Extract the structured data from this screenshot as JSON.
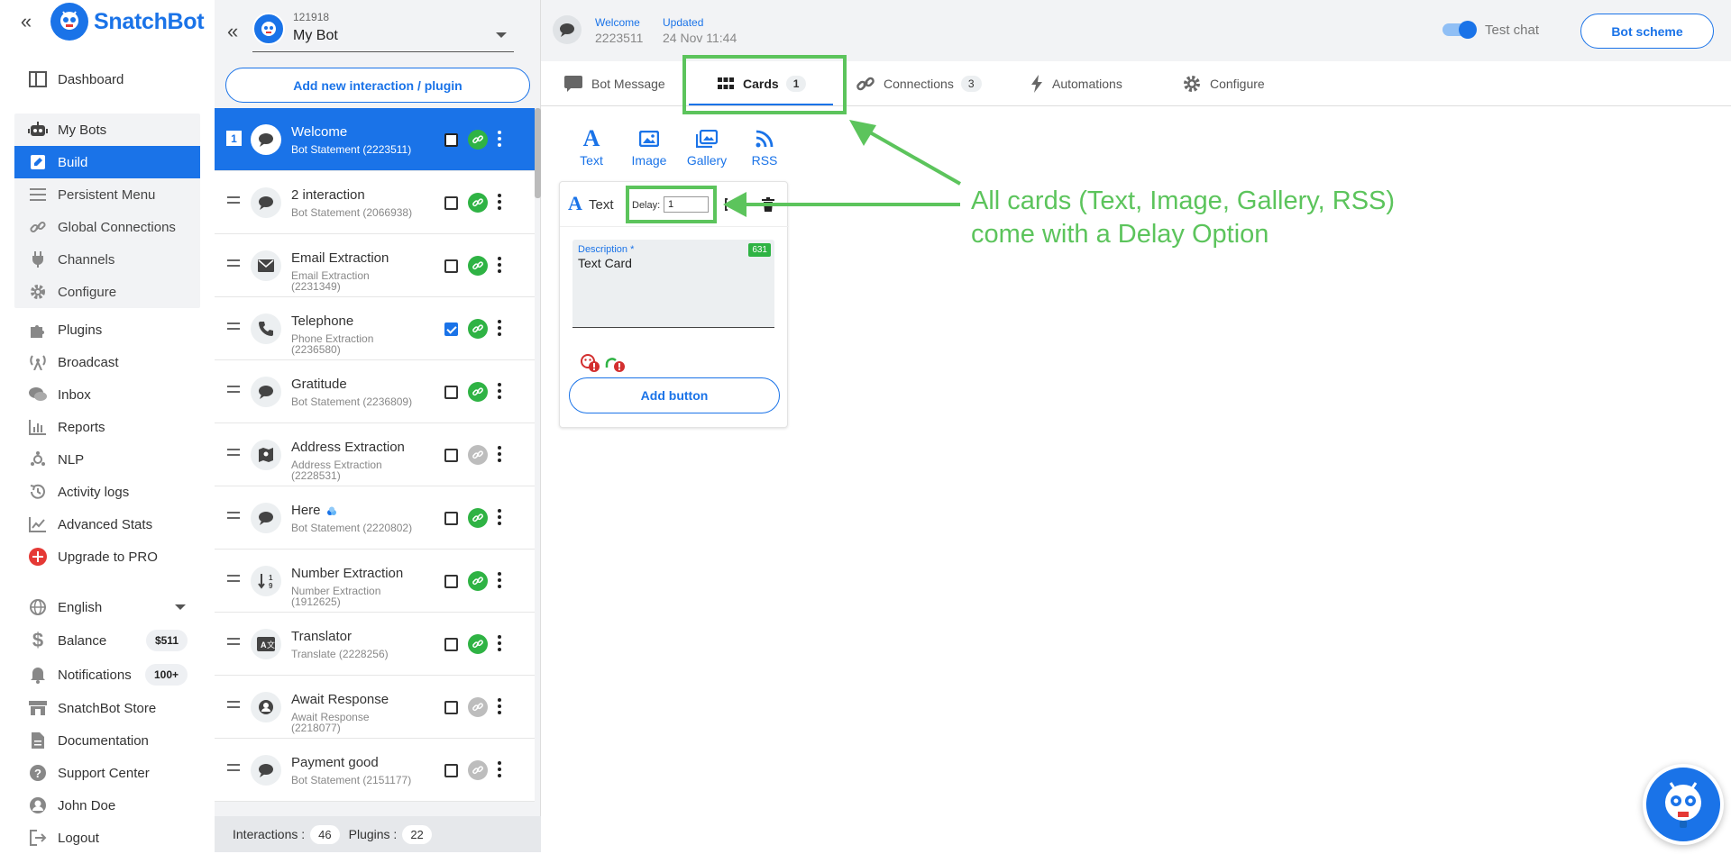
{
  "brand": {
    "name": "SnatchBot",
    "color": "#1a73e8"
  },
  "sidebar": {
    "collapse_icon": "double-chevron-left-icon",
    "items": [
      {
        "label": "Dashboard",
        "icon": "dashboard-icon"
      },
      {
        "label": "My Bots",
        "icon": "robot-icon"
      },
      {
        "label": "Build",
        "icon": "edit-icon"
      },
      {
        "label": "Persistent Menu",
        "icon": "menu-icon"
      },
      {
        "label": "Global Connections",
        "icon": "link-icon"
      },
      {
        "label": "Channels",
        "icon": "plug-icon"
      },
      {
        "label": "Configure",
        "icon": "gear-icon"
      },
      {
        "label": "Plugins",
        "icon": "puzzle-icon"
      },
      {
        "label": "Broadcast",
        "icon": "broadcast-icon"
      },
      {
        "label": "Inbox",
        "icon": "chat-icon"
      },
      {
        "label": "Reports",
        "icon": "bar-chart-icon"
      },
      {
        "label": "NLP",
        "icon": "nlp-icon"
      },
      {
        "label": "Activity logs",
        "icon": "history-icon"
      },
      {
        "label": "Advanced Stats",
        "icon": "trend-icon"
      },
      {
        "label": "Upgrade to PRO",
        "icon": "plus-circle-icon"
      },
      {
        "label": "English",
        "icon": "globe-icon"
      },
      {
        "label": "Balance",
        "icon": "dollar-icon",
        "badge": "$511"
      },
      {
        "label": "Notifications",
        "icon": "bell-icon",
        "badge": "100+"
      },
      {
        "label": "SnatchBot Store",
        "icon": "store-icon"
      },
      {
        "label": "Documentation",
        "icon": "document-icon"
      },
      {
        "label": "Support Center",
        "icon": "help-icon"
      },
      {
        "label": "John Doe",
        "icon": "user-icon"
      },
      {
        "label": "Logout",
        "icon": "logout-icon"
      }
    ]
  },
  "bot_panel": {
    "bot_id": "121918",
    "bot_name": "My Bot",
    "add_label": "Add new interaction / plugin",
    "interactions": [
      {
        "num": "1",
        "title": "Welcome",
        "sub": "Bot Statement (2223511)",
        "icon": "speech-bubble-icon",
        "checked": false,
        "linked": true,
        "selected": true
      },
      {
        "title": "2 interaction",
        "sub": "Bot Statement (2066938)",
        "icon": "speech-bubble-icon",
        "checked": false,
        "linked": true
      },
      {
        "title": "Email Extraction",
        "sub": "Email Extraction (2231349)",
        "icon": "envelope-icon",
        "checked": false,
        "linked": true
      },
      {
        "title": "Telephone",
        "sub": "Phone Extraction (2236580)",
        "icon": "phone-icon",
        "checked": true,
        "linked": true
      },
      {
        "title": "Gratitude",
        "sub": "Bot Statement (2236809)",
        "icon": "speech-bubble-icon",
        "checked": false,
        "linked": true
      },
      {
        "title": "Address Extraction",
        "sub": "Address Extraction (2228531)",
        "icon": "map-icon",
        "checked": false,
        "linked": false
      },
      {
        "title": "Here",
        "sub": "Bot Statement (2220802)",
        "icon": "speech-bubble-icon",
        "checked": false,
        "linked": true,
        "extra_icon": "nlp-icon"
      },
      {
        "title": "Number Extraction",
        "sub": "Number Extraction (1912625)",
        "icon": "number-sort-icon",
        "checked": false,
        "linked": true
      },
      {
        "title": "Translator",
        "sub": "Translate (2228256)",
        "icon": "translate-icon",
        "checked": false,
        "linked": true
      },
      {
        "title": "Await Response",
        "sub": "Await Response (2218077)",
        "icon": "user-circle-icon",
        "checked": false,
        "linked": false
      },
      {
        "title": "Payment good",
        "sub": "Bot Statement (2151177)",
        "icon": "speech-bubble-icon",
        "checked": false,
        "linked": false
      }
    ],
    "footer": {
      "interactions_label": "Interactions :",
      "interactions_count": "46",
      "plugins_label": "Plugins :",
      "plugins_count": "22"
    }
  },
  "header": {
    "welcome_label": "Welcome",
    "welcome_id": "2223511",
    "updated_label": "Updated",
    "updated_value": "24 Nov 11:44",
    "test_chat_label": "Test chat",
    "test_chat_on": true,
    "bot_scheme_label": "Bot scheme"
  },
  "tabs": [
    {
      "label": "Bot Message",
      "icon": "message-icon"
    },
    {
      "label": "Cards",
      "icon": "grid-icon",
      "count": "1",
      "active": true
    },
    {
      "label": "Connections",
      "icon": "link-icon",
      "count": "3"
    },
    {
      "label": "Automations",
      "icon": "bolt-icon"
    },
    {
      "label": "Configure",
      "icon": "gear-icon"
    }
  ],
  "card_types": [
    {
      "label": "Text",
      "icon": "text-a-icon"
    },
    {
      "label": "Image",
      "icon": "image-icon"
    },
    {
      "label": "Gallery",
      "icon": "gallery-icon"
    },
    {
      "label": "RSS",
      "icon": "rss-icon"
    }
  ],
  "card": {
    "type_label": "Text",
    "delay_label": "Delay:",
    "delay_value": "1",
    "description_label": "Description *",
    "description_value": "Text Card",
    "char_count": "631",
    "add_button_label": "Add button"
  },
  "annotation": {
    "line1": "All cards (Text, Image, Gallery, RSS)",
    "line2": "come with a Delay Option",
    "color": "#5cc45c"
  }
}
